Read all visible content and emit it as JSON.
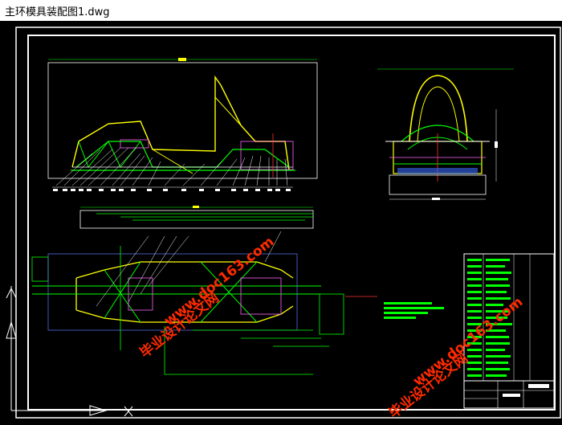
{
  "window": {
    "title": "主环模具装配图1.dwg"
  },
  "watermarks": [
    {
      "text": "毕业设计论文网"
    },
    {
      "text": "www.doc163.com"
    }
  ],
  "colors": {
    "background": "#000000",
    "frame": "#ffffff",
    "part": "#ffff00",
    "part_alt": "#00ff00",
    "dimension": "#ffffff",
    "watermark": "#ff2a00"
  },
  "icons": {
    "ucs": "ucs-axis-icon"
  }
}
